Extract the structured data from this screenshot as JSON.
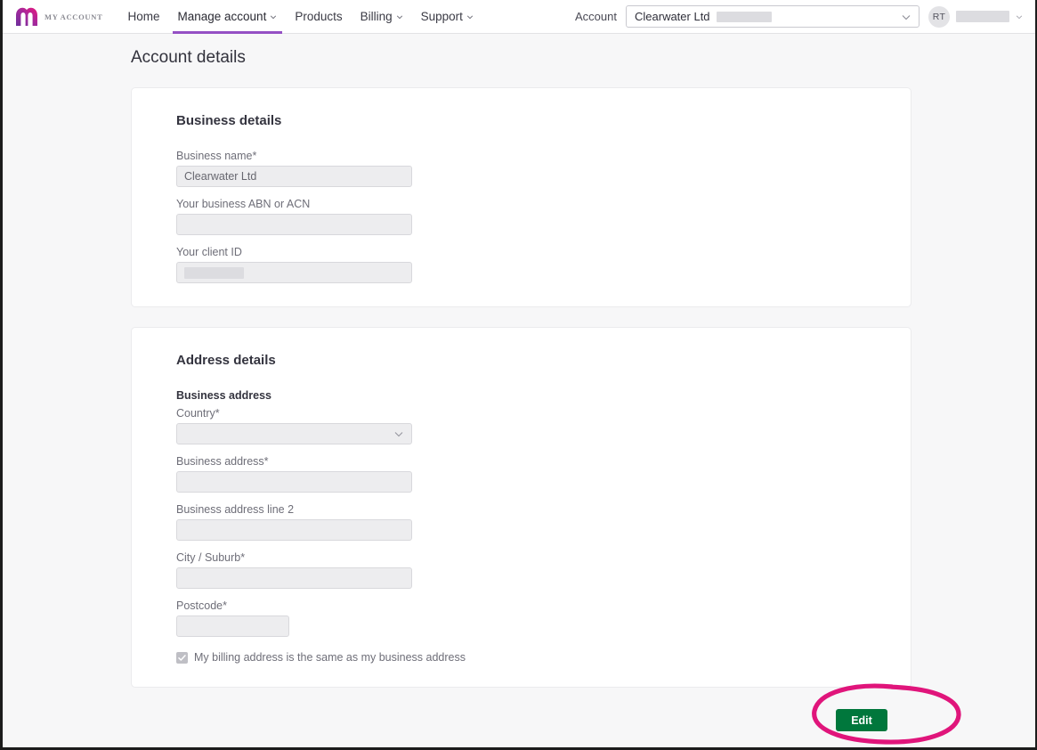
{
  "header": {
    "brand": {
      "logo_icon": "m-logo-icon",
      "text": "MY ACCOUNT"
    },
    "nav": [
      {
        "label": "Home",
        "has_caret": false,
        "active": false
      },
      {
        "label": "Manage account",
        "has_caret": true,
        "active": true
      },
      {
        "label": "Products",
        "has_caret": false,
        "active": false
      },
      {
        "label": "Billing",
        "has_caret": true,
        "active": false
      },
      {
        "label": "Support",
        "has_caret": true,
        "active": false
      }
    ],
    "account": {
      "label": "Account",
      "selected": "Clearwater Ltd",
      "redacted": true
    },
    "user": {
      "initials": "RT",
      "name_redacted": true
    }
  },
  "page": {
    "title": "Account details"
  },
  "business_details": {
    "title": "Business details",
    "fields": [
      {
        "label": "Business name",
        "required": true,
        "value": "Clearwater Ltd",
        "redacted": false,
        "type": "text"
      },
      {
        "label": "Your business ABN or ACN",
        "required": false,
        "value": "",
        "redacted": false,
        "type": "text"
      },
      {
        "label": "Your client ID",
        "required": false,
        "value": "",
        "redacted": true,
        "type": "text"
      }
    ]
  },
  "address_details": {
    "title": "Address details",
    "subhead": "Business address",
    "fields": [
      {
        "label": "Country",
        "required": true,
        "value": "",
        "type": "select"
      },
      {
        "label": "Business address",
        "required": true,
        "value": "",
        "type": "text"
      },
      {
        "label": "Business address line 2",
        "required": false,
        "value": "",
        "type": "text"
      },
      {
        "label": "City / Suburb",
        "required": true,
        "value": "",
        "type": "text"
      },
      {
        "label": "Postcode",
        "required": true,
        "value": "",
        "type": "text-narrow"
      }
    ],
    "checkbox": {
      "label": "My billing address is the same as my business address",
      "checked": true
    }
  },
  "footer": {
    "edit_label": "Edit"
  },
  "annotation": {
    "shape": "ellipse-highlight",
    "color": "#e0157b"
  },
  "colors": {
    "accent_purple": "#9450c4",
    "brand_magenta": "#d6167f",
    "button_green": "#00773c",
    "annotation_pink": "#e0157b",
    "page_bg": "#f7f7f8"
  },
  "required_marker": "*"
}
